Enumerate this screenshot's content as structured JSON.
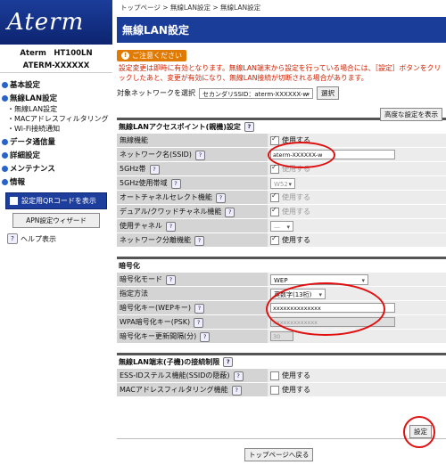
{
  "sidebar": {
    "logo": "Aterm",
    "model_line1": "Aterm　HT100LN",
    "model_line2": "ATERM-XXXXXX",
    "nav": [
      {
        "label": "基本設定",
        "subs": []
      },
      {
        "label": "無線LAN設定",
        "subs": [
          "・無線LAN設定",
          "・MACアドレスフィルタリング",
          "・Wi-Fi接続通知"
        ]
      },
      {
        "label": "データ通信量",
        "subs": []
      },
      {
        "label": "詳細設定",
        "subs": []
      },
      {
        "label": "メンテナンス",
        "subs": []
      },
      {
        "label": "情報",
        "subs": []
      }
    ],
    "qr_button": "設定用QRコードを表示",
    "apn_button": "APN設定ウィザード",
    "help": "ヘルプ表示"
  },
  "breadcrumb": "トップページ > 無線LAN設定 > 無線LAN設定",
  "title": "無線LAN設定",
  "notice_badge": "ご注意ください",
  "warning": "設定変更は即時に有効となります。無線LAN端末から設定を行っている場合には、［設定］ボタンをクリックしたあと、変更が有効になり、無線LAN接続が切断される場合があります。",
  "target": {
    "label": "対象ネットワークを選択",
    "value": "セカンダリSSID：aterm-XXXXXX-w",
    "select_button": "選択"
  },
  "advanced_button": "高度な設定を表示",
  "section1": {
    "title": "無線LANアクセスポイント(親機)設定",
    "rows": [
      {
        "label": "無線機能",
        "value": "使用する"
      },
      {
        "label": "ネットワーク名(SSID)",
        "value": "aterm-XXXXXX-w"
      },
      {
        "label": "5GHz帯",
        "value": "使用する"
      },
      {
        "label": "5GHz使用帯域",
        "value": "W52"
      },
      {
        "label": "オートチャネルセレクト機能",
        "value": "使用する"
      },
      {
        "label": "デュアル/クワッドチャネル機能",
        "value": "使用する"
      },
      {
        "label": "使用チャネル",
        "value": "—"
      },
      {
        "label": "ネットワーク分離機能",
        "value": "使用する"
      }
    ]
  },
  "section2": {
    "title": "暗号化",
    "rows": [
      {
        "label": "暗号化モード",
        "value": "WEP"
      },
      {
        "label": "指定方法",
        "value": "英数字(13桁)"
      },
      {
        "label": "暗号化キー(WEPキー)",
        "value": "xxxxxxxxxxxxxx"
      },
      {
        "label": "WPA暗号化キー(PSK)",
        "value": "xxxxxxxxxxxxx"
      },
      {
        "label": "暗号化キー更新間隔(分)",
        "value": "30"
      }
    ]
  },
  "section3": {
    "title": "無線LAN端末(子機)の接続制限",
    "rows": [
      {
        "label": "ESS-IDステルス機能(SSIDの隠蔽)",
        "value": "使用する"
      },
      {
        "label": "MACアドレスフィルタリング機能",
        "value": "使用する"
      }
    ]
  },
  "set_button": "設定",
  "top_button": "トップページへ戻る",
  "colors": {
    "brand": "#1b3d9a",
    "warning": "#d02000",
    "highlight": "#e01010"
  }
}
